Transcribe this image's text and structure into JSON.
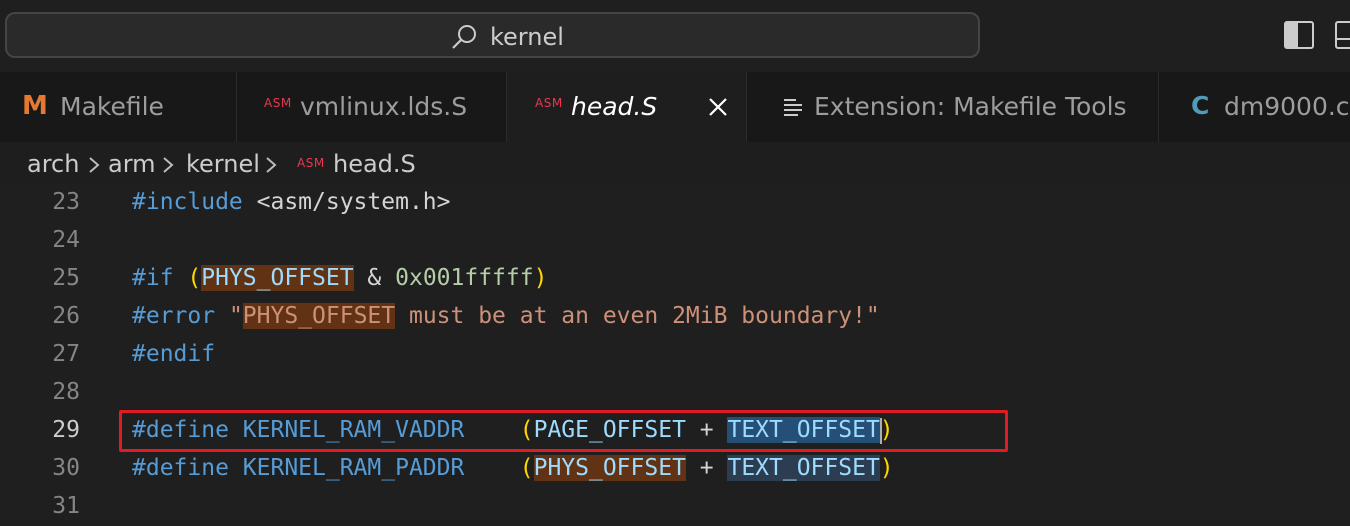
{
  "titlebar": {
    "search_text": "kernel"
  },
  "tabs": [
    {
      "label": "Makefile",
      "icon": "makefile-icon",
      "icon_glyph": "M"
    },
    {
      "label": "vmlinux.lds.S",
      "icon": "asm-icon",
      "icon_glyph": "ASM"
    },
    {
      "label": "head.S",
      "icon": "asm-icon",
      "icon_glyph": "ASM",
      "active": true
    },
    {
      "label": "Extension: Makefile Tools",
      "icon": "list-icon"
    },
    {
      "label": "dm9000.c",
      "icon": "c-file-icon",
      "icon_glyph": "C"
    }
  ],
  "breadcrumb": {
    "items": [
      "arch",
      "arm",
      "kernel",
      "head.S"
    ],
    "file_icon_glyph": "ASM"
  },
  "editor": {
    "current_line": "29",
    "lines": [
      {
        "num": "23",
        "t1": "#include",
        "t2": " <asm/system.h>"
      },
      {
        "num": "24"
      },
      {
        "num": "25",
        "t1": "#if",
        "t2": " (",
        "t3": "PHYS_OFFSET",
        "t4": " & ",
        "t5": "0x001fffff",
        "t6": ")"
      },
      {
        "num": "26",
        "t1": "#error",
        "t2": " \"",
        "t3": "PHYS_OFFSET",
        "t4": " must be at an even 2MiB boundary!\""
      },
      {
        "num": "27",
        "t1": "#endif"
      },
      {
        "num": "28"
      },
      {
        "num": "29",
        "t1": "#define",
        "t2": " KERNEL_RAM_VADDR",
        "t3": "    (",
        "t4": "PAGE_OFFSET",
        "t5": " + ",
        "t6": "TEXT_OFFSET",
        "t7": ")"
      },
      {
        "num": "30",
        "t1": "#define",
        "t2": " KERNEL_RAM_PADDR",
        "t3": "    (",
        "t4": "PHYS_OFFSET",
        "t5": " + ",
        "t6": "TEXT_OFFSET",
        "t7": ")"
      },
      {
        "num": "31"
      }
    ]
  },
  "colors": {
    "accent_highlight": "#613214",
    "selection": "#264f78",
    "annotation_box": "#e01b24"
  }
}
